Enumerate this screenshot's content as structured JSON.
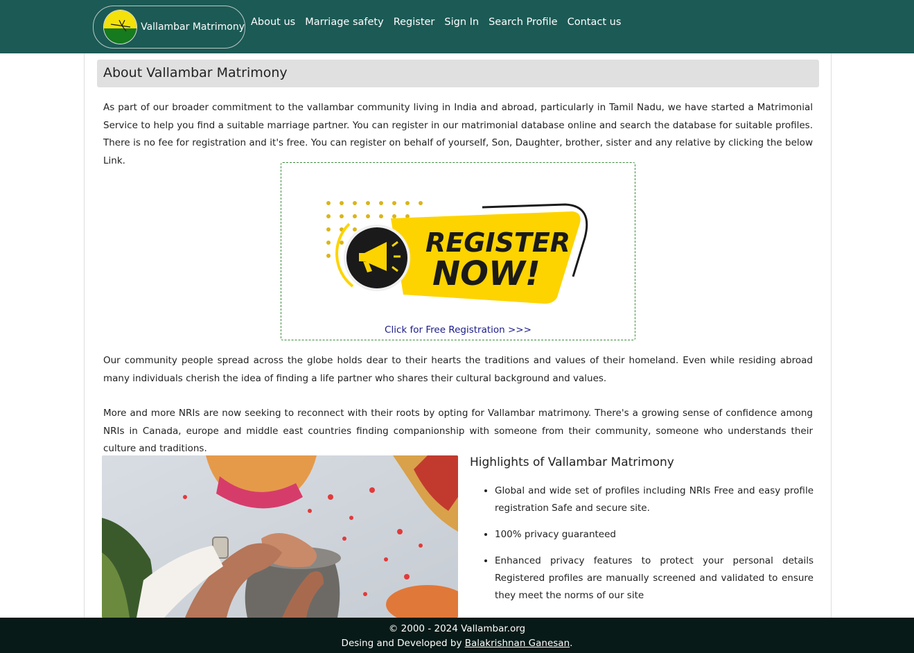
{
  "navbar": {
    "brand_name": "Vallambar Matrimony",
    "bg_color": "#1c5a55",
    "items": [
      {
        "label": "About us",
        "name": "nav-about-us"
      },
      {
        "label": "Marriage safety",
        "name": "nav-marriage-safety"
      },
      {
        "label": "Register",
        "name": "nav-register"
      },
      {
        "label": "Sign In",
        "name": "nav-sign-in"
      },
      {
        "label": "Search Profile",
        "name": "nav-search-profile"
      },
      {
        "label": "Contact us",
        "name": "nav-contact-us"
      }
    ]
  },
  "main": {
    "title": "About Vallambar Matrimony",
    "intro": "As part of our broader commitment to the vallambar community living in India and abroad, particularly in Tamil Nadu, we have started a Matrimonial Service to help you find a suitable marriage partner. You can register in our matrimonial database online and search the database for suitable profiles. There is no fee for registration and it's free. You can register on behalf of yourself, Son, Daughter, brother, sister and any relative by clicking the below Link.",
    "register_banner": {
      "line1": "REGISTER",
      "line2": "NOW!",
      "link_text": "Click for Free Registration >>>",
      "accent_color": "#fdd400"
    },
    "community_text": "Our community people spread across the globe holds dear to their hearts the traditions and values of their homeland. Even while residing abroad many individuals cherish the idea of finding a life partner who shares their cultural background and values.",
    "nri_text": "More and more NRIs are now seeking to reconnect with their roots by opting for Vallambar matrimony. There's a growing sense of confidence among NRIs in Canada, europe and middle east countries finding companionship with someone from their community, someone who understands their culture and traditions.",
    "highlights": {
      "title": "Highlights of Vallambar Matrimony",
      "items": [
        "Global and wide set of profiles including NRIs Free and easy profile registration Safe and secure site.",
        "100% privacy guaranteed",
        "Enhanced privacy features to protect your personal details Registered profiles are manually screened and validated to ensure they meet the norms of our site"
      ]
    }
  },
  "footer": {
    "copyright": "© 2000 - 2024 Vallambar.org",
    "credit_prefix": "Desing and Developed by ",
    "credit_name": "Balakrishnan Ganesan",
    "credit_suffix": "."
  }
}
